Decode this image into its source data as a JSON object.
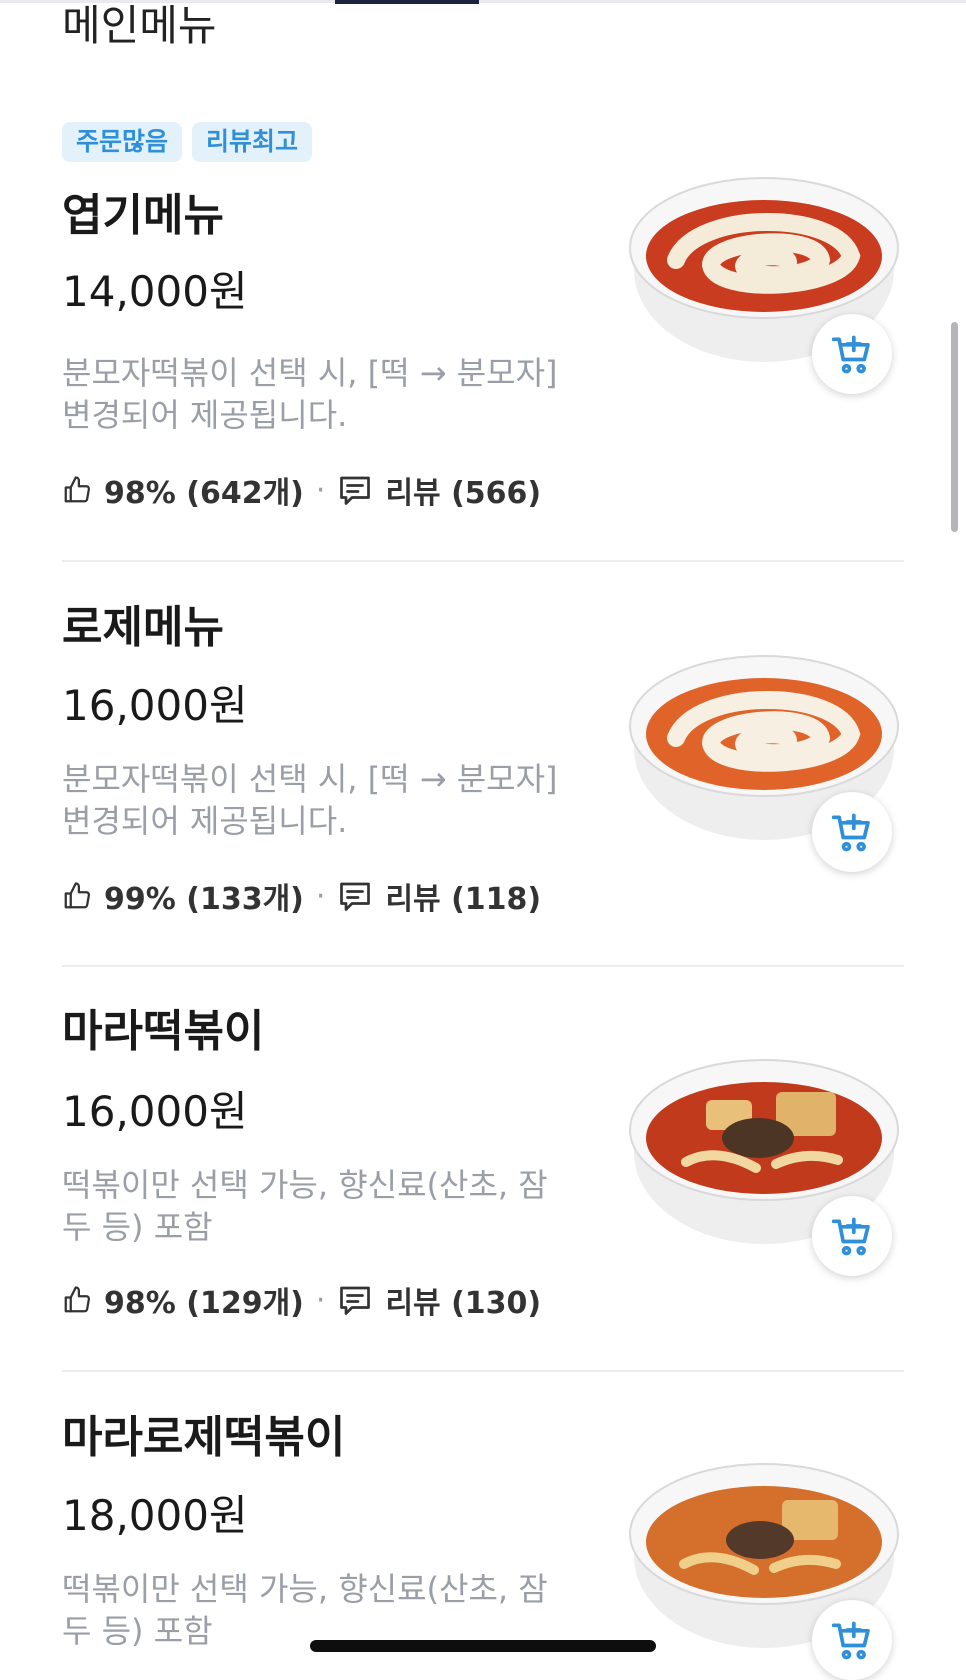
{
  "section": {
    "title": "메인메뉴"
  },
  "badges": [
    "주문많음",
    "리뷰최고"
  ],
  "menu_items": [
    {
      "name": "엽기메뉴",
      "price": "14,000원",
      "desc": "분모자떡볶이 선택 시, [떡 → 분모자] 변경되어 제공됩니다.",
      "like": "98% (642개)",
      "reviews": "리뷰 (566)",
      "sauce": "#c93c1f"
    },
    {
      "name": "로제메뉴",
      "price": "16,000원",
      "desc": "분모자떡볶이 선택 시, [떡 → 분모자] 변경되어 제공됩니다.",
      "like": "99% (133개)",
      "reviews": "리뷰 (118)",
      "sauce": "#e0642a"
    },
    {
      "name": "마라떡볶이",
      "price": "16,000원",
      "desc": "떡볶이만 선택 가능, 향신료(산초, 잠두 등) 포함",
      "like": "98% (129개)",
      "reviews": "리뷰 (130)",
      "sauce": "#c23a1c"
    },
    {
      "name": "마라로제떡볶이",
      "price": "18,000원",
      "desc": "떡볶이만 선택 가능, 향신료(산초, 잠두 등) 포함",
      "sauce": "#d5702c"
    }
  ],
  "icons": {
    "like": "thumbs-up-icon",
    "review": "speech-bubble-icon",
    "cart": "add-to-cart-icon"
  },
  "colors": {
    "badge_bg": "#e3f1fb",
    "badge_text": "#2f8fd8",
    "cart_icon": "#2f8fd8",
    "desc_text": "#9a9ea6"
  }
}
